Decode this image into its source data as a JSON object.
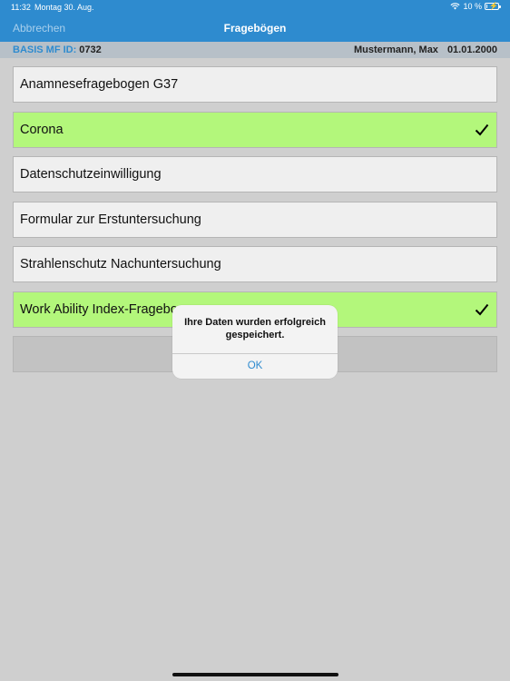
{
  "status": {
    "time": "11:32",
    "date": "Montag 30. Aug.",
    "battery": "10 %",
    "battery_level": 0.1
  },
  "nav": {
    "cancel_label": "Abbrechen",
    "title": "Fragebögen"
  },
  "info": {
    "id_label": "BASIS MF ID:",
    "id_value": "0732",
    "patient_name": "Mustermann, Max",
    "birth_date": "01.01.2000"
  },
  "questionnaires": [
    {
      "label": "Anamnesefragebogen G37",
      "completed": false
    },
    {
      "label": "Corona",
      "completed": true
    },
    {
      "label": "Datenschutzeinwilligung",
      "completed": false
    },
    {
      "label": "Formular zur Erstuntersuchung",
      "completed": false
    },
    {
      "label": "Strahlenschutz Nachuntersuchung",
      "completed": false
    },
    {
      "label": "Work Ability Index-Fragebogen",
      "completed": true
    }
  ],
  "dialog": {
    "message": "Ihre Daten wurden erfolgreich gespeichert.",
    "ok_label": "OK"
  },
  "colors": {
    "accent": "#2e8bcf",
    "completed_bg": "#b3f77b",
    "row_bg": "#efefef"
  }
}
